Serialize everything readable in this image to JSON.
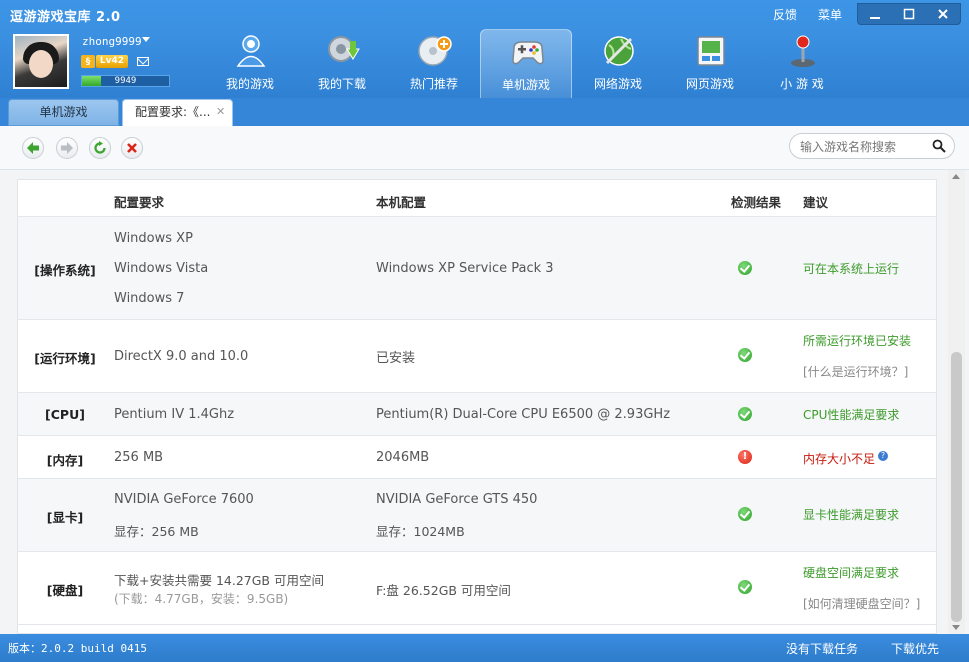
{
  "app": {
    "title": "逗游游戏宝库 2.0",
    "feedback": "反馈",
    "menu": "菜单"
  },
  "user": {
    "name": "zhong9999",
    "level": "Lv42",
    "xp": "9949",
    "xp_fraction": 0.22
  },
  "nav": [
    {
      "label": "我的游戏",
      "icon": "my-games-icon"
    },
    {
      "label": "我的下载",
      "icon": "download-icon"
    },
    {
      "label": "热门推荐",
      "icon": "hot-recommend-icon"
    },
    {
      "label": "单机游戏",
      "icon": "gamepad-icon",
      "active": true
    },
    {
      "label": "网络游戏",
      "icon": "online-game-icon"
    },
    {
      "label": "网页游戏",
      "icon": "web-game-icon"
    },
    {
      "label": "小 游 戏",
      "icon": "joystick-icon"
    }
  ],
  "tabs": {
    "tab1": "单机游戏",
    "tab2": "配置要求:《..."
  },
  "search": {
    "placeholder": "输入游戏名称搜索"
  },
  "table": {
    "headers": {
      "requirement": "配置要求",
      "local": "本机配置",
      "result": "检测结果",
      "advice": "建议"
    },
    "rows": {
      "os": {
        "label": "[操作系统]",
        "req": [
          "Windows XP",
          "Windows Vista",
          "Windows 7"
        ],
        "local": "Windows XP Service Pack 3",
        "advice": "可在本系统上运行"
      },
      "env": {
        "label": "[运行环境]",
        "req": "DirectX 9.0 and 10.0",
        "local": "已安装",
        "advice": "所需运行环境已安装",
        "help": "[什么是运行环境？]"
      },
      "cpu": {
        "label": "[CPU]",
        "req": "Pentium IV 1.4Ghz",
        "local": "Pentium(R) Dual-Core CPU E6500 @ 2.93GHz",
        "advice": "CPU性能满足要求"
      },
      "mem": {
        "label": "[内存]",
        "req": "256 MB",
        "local": "2046MB",
        "advice": "内存大小不足"
      },
      "gpu": {
        "label": "[显卡]",
        "req": "NVIDIA GeForce 7600",
        "req_vram": "显存：256 MB",
        "local": "NVIDIA GeForce GTS 450",
        "local_vram": "显存：1024MB",
        "advice": "显卡性能满足要求"
      },
      "disk": {
        "label": "[硬盘]",
        "req": "下载+安装共需要  14.27GB 可用空间",
        "req_detail": "(下载：4.77GB，安装：9.5GB)",
        "local": "F:盘  26.52GB 可用空间",
        "advice": "硬盘空间满足要求",
        "help": "[如何清理硬盘空间？]"
      }
    }
  },
  "status": {
    "version": "版本：2.0.2 build 0415",
    "task": "没有下载任务",
    "priority": "下载优先"
  },
  "colors": {
    "header_blue": "#3b8fe0",
    "ok_green": "#3d9b2c",
    "warn_red": "#c61a0e"
  }
}
